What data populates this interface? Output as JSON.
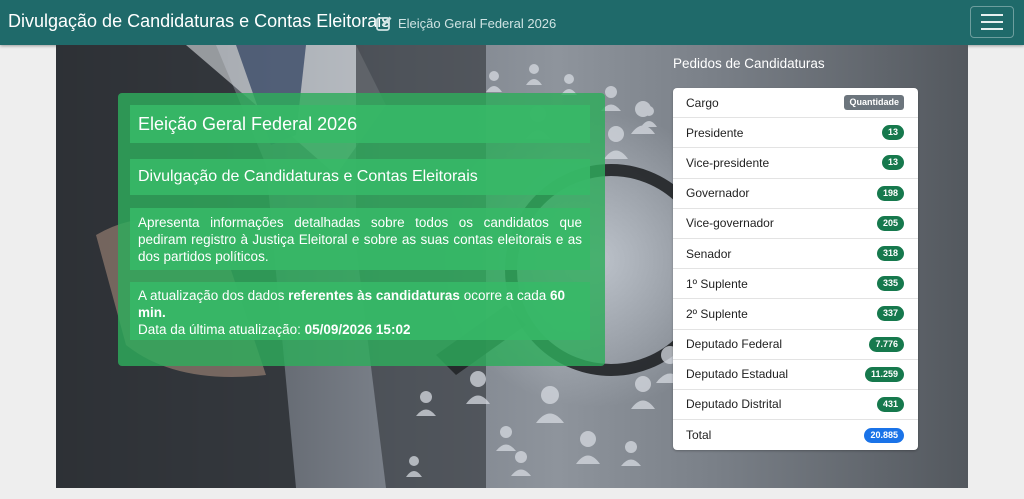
{
  "navbar": {
    "brand": "Divulgação de Candidaturas e Contas Eleitorais",
    "election": "Eleição Geral Federal 2026",
    "edit_icon": "edit-square-icon",
    "menu_icon": "hamburger-menu-icon"
  },
  "hero": {
    "title": "Eleição Geral Federal 2026",
    "subtitle": "Divulgação de Candidaturas e Contas Eleitorais",
    "description": "Apresenta informações detalhadas sobre todos os candidatos que pediram registro à Justiça Eleitoral e sobre as suas contas eleitorais e as dos partidos políticos.",
    "update_prefix": "A atualização dos dados ",
    "update_bold": "referentes às candidaturas",
    "update_middle": " ocorre a cada ",
    "update_interval": "60 min.",
    "last_update_label": "Data da última atualização: ",
    "last_update_value": "05/09/2026 15:02"
  },
  "candidaturas": {
    "title": "Pedidos de Candidaturas",
    "header": {
      "label": "Cargo",
      "badge": "Quantidade"
    },
    "rows": [
      {
        "label": "Presidente",
        "value": "13"
      },
      {
        "label": "Vice-presidente",
        "value": "13"
      },
      {
        "label": "Governador",
        "value": "198"
      },
      {
        "label": "Vice-governador",
        "value": "205"
      },
      {
        "label": "Senador",
        "value": "318"
      },
      {
        "label": "1º Suplente",
        "value": "335"
      },
      {
        "label": "2º Suplente",
        "value": "337"
      },
      {
        "label": "Deputado Federal",
        "value": "7.776"
      },
      {
        "label": "Deputado Estadual",
        "value": "11.259"
      },
      {
        "label": "Deputado Distrital",
        "value": "431"
      }
    ],
    "total": {
      "label": "Total",
      "value": "20.885"
    }
  },
  "colors": {
    "navbar": "#1f6a6a",
    "hero_box": "#2eac5c",
    "badge_green": "#16794d",
    "badge_total": "#1a73e8"
  }
}
